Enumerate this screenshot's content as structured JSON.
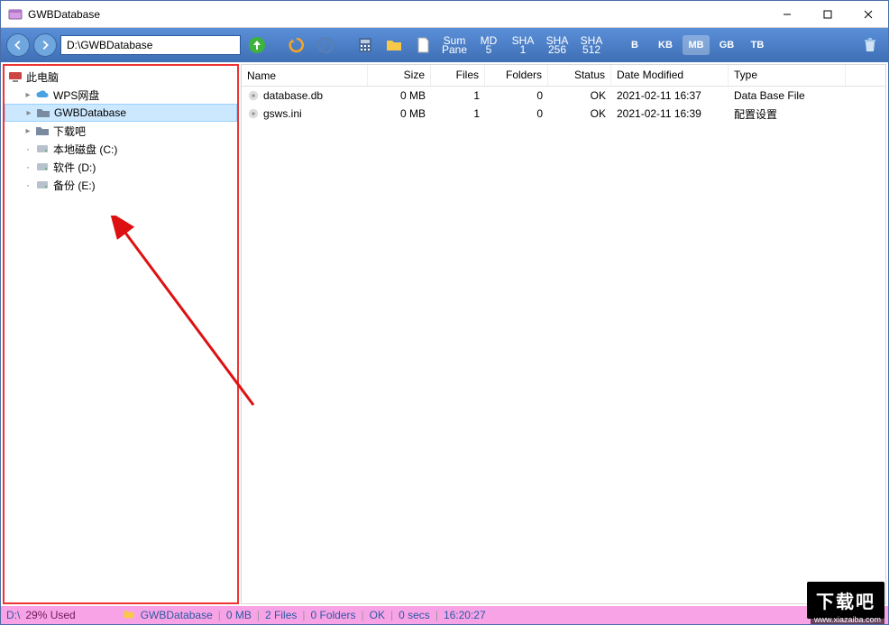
{
  "window": {
    "title": "GWBDatabase"
  },
  "toolbar": {
    "path": "D:\\GWBDatabase",
    "tools": [
      {
        "line1": "Sum",
        "line2": "Pane"
      },
      {
        "line1": "MD",
        "line2": "5"
      },
      {
        "line1": "SHA",
        "line2": "1"
      },
      {
        "line1": "SHA",
        "line2": "256"
      },
      {
        "line1": "SHA",
        "line2": "512"
      }
    ],
    "units": [
      "B",
      "KB",
      "MB",
      "GB",
      "TB"
    ],
    "active_unit": "MB"
  },
  "tree": {
    "root": "此电脑",
    "items": [
      {
        "label": "WPS网盘",
        "icon": "cloud",
        "selected": false,
        "expander": "▸"
      },
      {
        "label": "GWBDatabase",
        "icon": "folder",
        "selected": true,
        "expander": "▸"
      },
      {
        "label": "下载吧",
        "icon": "folder",
        "selected": false,
        "expander": "▸"
      },
      {
        "label": "本地磁盘 (C:)",
        "icon": "disk",
        "selected": false,
        "expander": "·"
      },
      {
        "label": "软件 (D:)",
        "icon": "disk",
        "selected": false,
        "expander": "·"
      },
      {
        "label": "备份 (E:)",
        "icon": "disk",
        "selected": false,
        "expander": "·"
      }
    ]
  },
  "list": {
    "columns": [
      "Name",
      "Size",
      "Files",
      "Folders",
      "Status",
      "Date Modified",
      "Type"
    ],
    "rows": [
      {
        "name": "database.db",
        "size": "0 MB",
        "files": "1",
        "folders": "0",
        "status": "OK",
        "date": "2021-02-11 16:37",
        "type": "Data Base File"
      },
      {
        "name": "gsws.ini",
        "size": "0 MB",
        "files": "1",
        "folders": "0",
        "status": "OK",
        "date": "2021-02-11 16:39",
        "type": "配置设置"
      }
    ]
  },
  "status": {
    "drive": "D:\\",
    "used": "29% Used",
    "folder": "GWBDatabase",
    "size": "0  MB",
    "files": "2 Files",
    "folders": "0 Folders",
    "ok": "OK",
    "secs": "0 secs",
    "time": "16:20:27"
  },
  "overlay": {
    "logo": "下载吧",
    "url": "www.xiazaiba.com"
  }
}
